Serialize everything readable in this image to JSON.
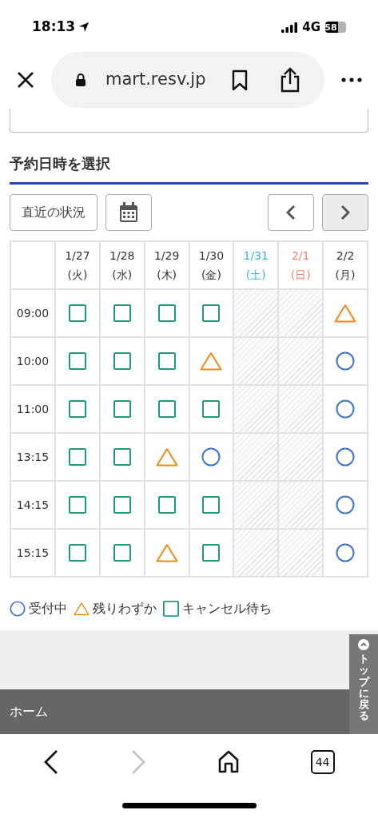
{
  "status_bar": {
    "time": "18:13",
    "network": "4G",
    "battery": "58"
  },
  "browser": {
    "url": "mart.resv.jp",
    "tab_count": "44"
  },
  "section_title": "予約日時を選択",
  "buttons": {
    "recent": "直近の状況"
  },
  "table": {
    "days": [
      {
        "date": "1/27",
        "weekday": "(火)",
        "color": "#333333"
      },
      {
        "date": "1/28",
        "weekday": "(水)",
        "color": "#333333"
      },
      {
        "date": "1/29",
        "weekday": "(木)",
        "color": "#333333"
      },
      {
        "date": "1/30",
        "weekday": "(金)",
        "color": "#333333"
      },
      {
        "date": "1/31",
        "weekday": "(土)",
        "color": "#3bb4e6"
      },
      {
        "date": "2/1",
        "weekday": "(日)",
        "color": "#f28574"
      },
      {
        "date": "2/2",
        "weekday": "(月)",
        "color": "#333333"
      }
    ],
    "rows": [
      {
        "time": "09:00",
        "slots": [
          {
            "kind": "square"
          },
          {
            "kind": "square"
          },
          {
            "kind": "square"
          },
          {
            "kind": "square"
          },
          {
            "kind": "closed"
          },
          {
            "kind": "closed"
          },
          {
            "kind": "triangle"
          }
        ]
      },
      {
        "time": "10:00",
        "slots": [
          {
            "kind": "square"
          },
          {
            "kind": "square"
          },
          {
            "kind": "square"
          },
          {
            "kind": "triangle"
          },
          {
            "kind": "closed"
          },
          {
            "kind": "closed"
          },
          {
            "kind": "circle"
          }
        ]
      },
      {
        "time": "11:00",
        "slots": [
          {
            "kind": "square"
          },
          {
            "kind": "square"
          },
          {
            "kind": "square"
          },
          {
            "kind": "square"
          },
          {
            "kind": "closed"
          },
          {
            "kind": "closed"
          },
          {
            "kind": "circle"
          }
        ]
      },
      {
        "time": "13:15",
        "slots": [
          {
            "kind": "square"
          },
          {
            "kind": "square"
          },
          {
            "kind": "triangle"
          },
          {
            "kind": "circle"
          },
          {
            "kind": "closed"
          },
          {
            "kind": "closed"
          },
          {
            "kind": "circle"
          }
        ]
      },
      {
        "time": "14:15",
        "slots": [
          {
            "kind": "square"
          },
          {
            "kind": "square"
          },
          {
            "kind": "square"
          },
          {
            "kind": "square"
          },
          {
            "kind": "closed"
          },
          {
            "kind": "closed"
          },
          {
            "kind": "circle"
          }
        ]
      },
      {
        "time": "15:15",
        "slots": [
          {
            "kind": "square"
          },
          {
            "kind": "square"
          },
          {
            "kind": "triangle"
          },
          {
            "kind": "square"
          },
          {
            "kind": "closed"
          },
          {
            "kind": "closed"
          },
          {
            "kind": "circle"
          }
        ]
      }
    ]
  },
  "legend": [
    {
      "kind": "circle",
      "label": "受付中"
    },
    {
      "kind": "triangle",
      "label": "残りわずか"
    },
    {
      "kind": "square",
      "label": "キャンセル待ち"
    }
  ],
  "footer": {
    "home_link": "ホーム",
    "back_to_top": "トップに戻る"
  }
}
